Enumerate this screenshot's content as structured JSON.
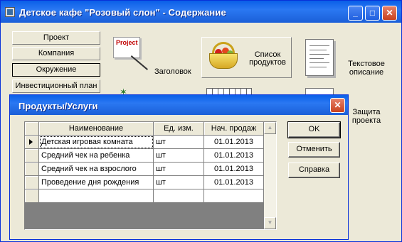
{
  "main_window": {
    "title": "Детское кафе \"Розовый слон\" - Содержание",
    "controls": {
      "minimize": "_",
      "maximize": "□",
      "close": "✕"
    },
    "nav_buttons": [
      "Проект",
      "Компания",
      "Окружение",
      "Инвестиционный план"
    ],
    "tiles": {
      "title_page": {
        "card_text": "Project",
        "label": "Заголовок"
      },
      "product_list": {
        "label_line1": "Список",
        "label_line2": "продуктов"
      },
      "text_description": {
        "label_line1": "Текстовое",
        "label_line2": "описание"
      },
      "project_protection": {
        "label_line1": "Защита",
        "label_line2": "проекта"
      }
    }
  },
  "dialog": {
    "title": "Продукты/Услуги",
    "close": "✕",
    "grid": {
      "columns": [
        "Наименование",
        "Ед. изм.",
        "Нач. продаж"
      ],
      "rows": [
        {
          "name": "Детская игровая комната",
          "unit": "шт",
          "start": "01.01.2013"
        },
        {
          "name": "Средний чек на ребенка",
          "unit": "шт",
          "start": "01.01.2013"
        },
        {
          "name": "Средний чек на взрослого",
          "unit": "шт",
          "start": "01.01.2013"
        },
        {
          "name": "Проведение дня рождения",
          "unit": "шт",
          "start": "01.01.2013"
        }
      ]
    },
    "buttons": {
      "ok": "OK",
      "cancel": "Отменить",
      "help": "Справка"
    }
  }
}
